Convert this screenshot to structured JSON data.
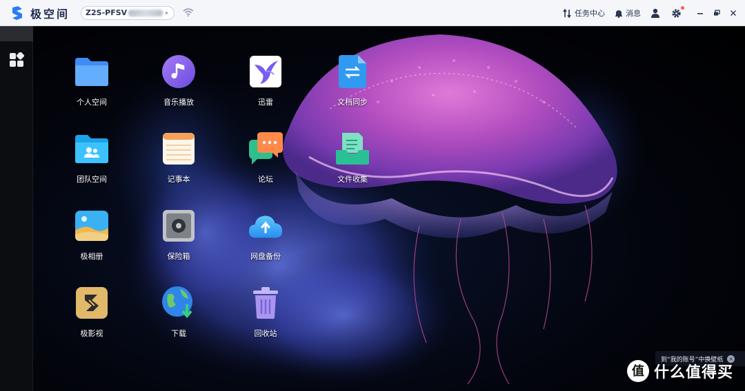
{
  "titlebar": {
    "app_name": "极空间",
    "device_name": "Z2S-PFSV",
    "tasks_label": "任务中心",
    "messages_label": "消息"
  },
  "desktop_apps": [
    {
      "id": "personal-space",
      "label": "个人空间",
      "icon": "folder-icon"
    },
    {
      "id": "music-player",
      "label": "音乐播放",
      "icon": "music-note-icon"
    },
    {
      "id": "xunlei",
      "label": "迅雷",
      "icon": "bird-icon"
    },
    {
      "id": "doc-sync",
      "label": "文档同步",
      "icon": "sync-doc-icon"
    },
    {
      "id": "team-space",
      "label": "团队空间",
      "icon": "team-folder-icon"
    },
    {
      "id": "notepad",
      "label": "记事本",
      "icon": "notepad-icon"
    },
    {
      "id": "forum",
      "label": "论坛",
      "icon": "chat-bubbles-icon"
    },
    {
      "id": "file-collect",
      "label": "文件收集",
      "icon": "file-collect-icon"
    },
    {
      "id": "photo-album",
      "label": "极相册",
      "icon": "photo-icon"
    },
    {
      "id": "safe-box",
      "label": "保险箱",
      "icon": "safe-icon"
    },
    {
      "id": "cloud-backup",
      "label": "网盘备份",
      "icon": "cloud-upload-icon"
    },
    {
      "id": "video",
      "label": "极影视",
      "icon": "video-logo-icon"
    },
    {
      "id": "download",
      "label": "下载",
      "icon": "globe-download-icon"
    },
    {
      "id": "recycle-bin",
      "label": "回收站",
      "icon": "trash-icon"
    }
  ],
  "toast": {
    "text": "到“我的账号”中换壁纸"
  },
  "watermark": {
    "text": "什么值得买"
  },
  "colors": {
    "accent": "#2a7cf6",
    "titlebar_bg": "#f4f6fa",
    "sidebar_bg": "#0c0d10"
  }
}
